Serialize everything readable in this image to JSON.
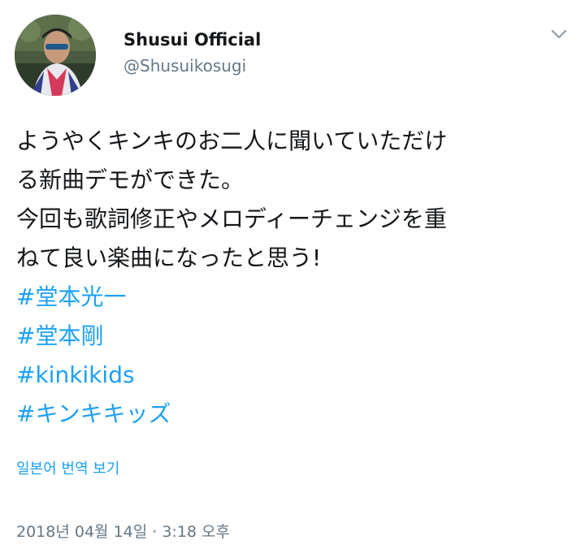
{
  "header": {
    "display_name": "Shusui Official",
    "handle": "@Shusuikosugi",
    "avatar_icon": "user-avatar-photo",
    "menu_icon": "chevron-down-icon"
  },
  "tweet": {
    "lines": [
      "ようやくキンキのお二人に聞いていただけ",
      "る新曲デモができた。",
      "今回も歌詞修正やメロディーチェンジを重",
      "ねて良い楽曲になったと思う!"
    ],
    "hashtags": [
      "#堂本光一",
      "#堂本剛",
      "#kinkikids",
      "#キンキキッズ"
    ]
  },
  "translate_label": "일본어 번역 보기",
  "timestamp": "2018년 04월 14일 · 3:18 오후",
  "colors": {
    "link": "#1da1f2",
    "secondary_text": "#657786",
    "primary_text": "#14171a"
  }
}
